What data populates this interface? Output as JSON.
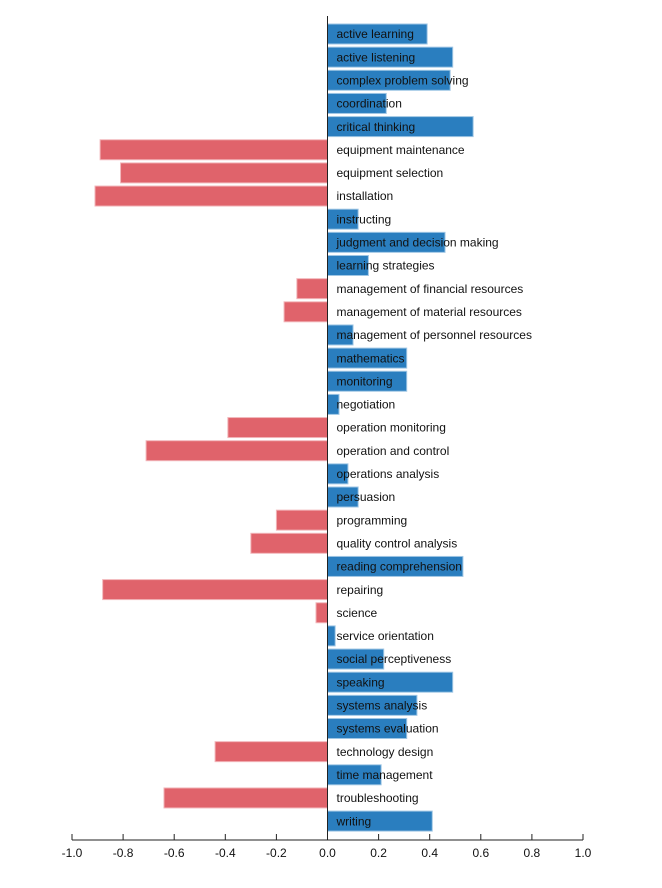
{
  "chart_data": {
    "type": "bar",
    "orientation": "horizontal",
    "title": "",
    "xlabel": "",
    "ylabel": "",
    "xlim": [
      -1.0,
      1.0
    ],
    "x_ticks": [
      "-1.0",
      "-0.8",
      "-0.6",
      "-0.4",
      "-0.2",
      "0.0",
      "0.2",
      "0.4",
      "0.6",
      "0.8",
      "1.0"
    ],
    "grid": false,
    "legend": "none",
    "colors": {
      "positive": "#2a7ebf",
      "negative": "#e0636b"
    },
    "categories": [
      "active learning",
      "active listening",
      "complex problem solving",
      "coordination",
      "critical thinking",
      "equipment maintenance",
      "equipment selection",
      "installation",
      "instructing",
      "judgment and decision making",
      "learning strategies",
      "management of financial resources",
      "management of material resources",
      "management of personnel resources",
      "mathematics",
      "monitoring",
      "negotiation",
      "operation monitoring",
      "operation and control",
      "operations analysis",
      "persuasion",
      "programming",
      "quality control analysis",
      "reading comprehension",
      "repairing",
      "science",
      "service orientation",
      "social perceptiveness",
      "speaking",
      "systems analysis",
      "systems evaluation",
      "technology design",
      "time management",
      "troubleshooting",
      "writing"
    ],
    "values": [
      0.39,
      0.49,
      0.48,
      0.23,
      0.57,
      -0.89,
      -0.81,
      -0.91,
      0.12,
      0.46,
      0.16,
      -0.12,
      -0.17,
      0.1,
      0.31,
      0.31,
      0.045,
      -0.39,
      -0.71,
      0.08,
      0.12,
      -0.2,
      -0.3,
      0.53,
      -0.88,
      -0.045,
      0.03,
      0.22,
      0.49,
      0.35,
      0.31,
      -0.44,
      0.21,
      -0.64,
      0.41
    ]
  }
}
